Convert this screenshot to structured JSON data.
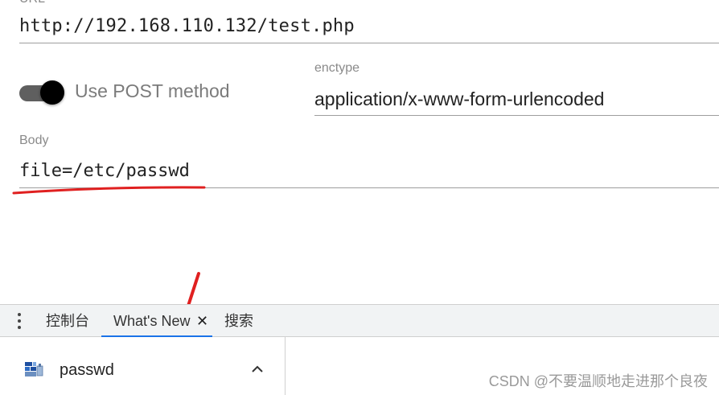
{
  "form": {
    "url_label": "URL",
    "url_value": "http://192.168.110.132/test.php",
    "post_toggle_label": "Use POST method",
    "post_toggle_on": true,
    "enctype_label": "enctype",
    "enctype_value": "application/x-www-form-urlencoded",
    "body_label": "Body",
    "body_value": "file=/etc/passwd"
  },
  "drawer": {
    "tabs": [
      {
        "label": "控制台"
      },
      {
        "label": "What's New",
        "active": true,
        "closable": true
      },
      {
        "label": "搜索"
      }
    ],
    "close_glyph": "✕",
    "accent_color": "#1a73e8"
  },
  "downloads": {
    "file_name": "passwd",
    "file_icon": "file-icon",
    "expand_icon": "chevron-up-icon"
  },
  "watermark": "CSDN @不要温顺地走进那个良夜",
  "annotation_color": "#e02020"
}
